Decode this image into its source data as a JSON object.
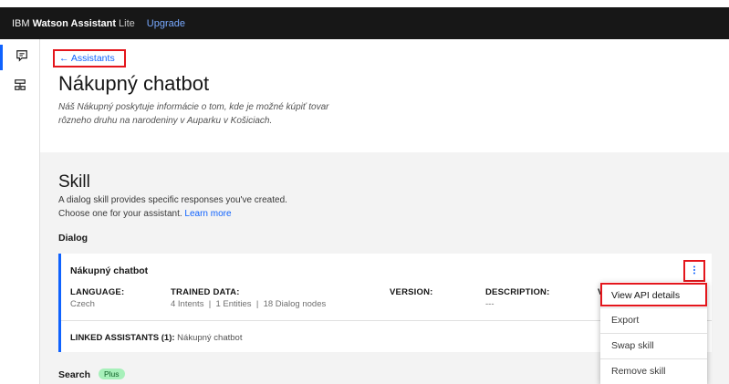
{
  "topbar": {
    "brand_prefix": "IBM",
    "brand_product": "Watson Assistant",
    "brand_tier": "Lite",
    "upgrade": "Upgrade"
  },
  "leftnav": {
    "items": [
      {
        "icon": "chat-icon",
        "active": true
      },
      {
        "icon": "skills-icon",
        "active": false
      }
    ]
  },
  "header": {
    "back": "← Assistants",
    "title": "Nákupný chatbot",
    "description": "Náš Nákupný poskytuje informácie o tom, kde je možné kúpiť tovar rôzneho druhu na narodeniny v Auparku v Košiciach."
  },
  "skill": {
    "title": "Skill",
    "desc_line1": "A dialog skill provides specific responses you've created.",
    "desc_line2": "Choose one for your assistant.",
    "learn_more": "Learn more",
    "dialog_label": "Dialog"
  },
  "card": {
    "name": "Nákupný chatbot",
    "language_h": "LANGUAGE:",
    "language_v": "Czech",
    "trained_h": "TRAINED DATA:",
    "trained_v": "4 Intents  |  1 Entities  |  18 Dialog nodes",
    "version_h": "VERSION:",
    "description_h": "DESCRIPTION:",
    "description_v": "---",
    "extra_h": "V",
    "linked_label": "LINKED ASSISTANTS (1):",
    "linked_value": "Nákupný chatbot"
  },
  "menu": {
    "items": [
      "View API details",
      "Export",
      "Swap skill",
      "Remove skill"
    ]
  },
  "search": {
    "label": "Search",
    "badge": "Plus"
  },
  "colors": {
    "accent": "#0f62fe",
    "highlight": "#e4161c",
    "topbar": "#171717"
  }
}
